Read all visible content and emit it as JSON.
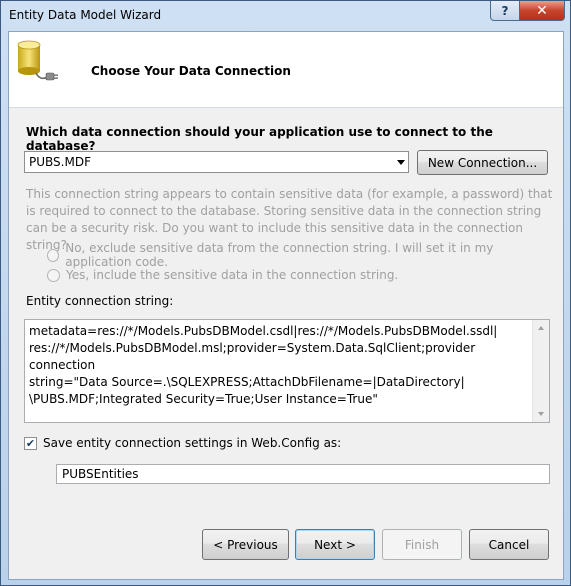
{
  "window": {
    "title": "Entity Data Model Wizard",
    "help_label": "?",
    "close_label": "✕"
  },
  "header": {
    "title": "Choose Your Data Connection",
    "icon": "database-connection-icon"
  },
  "question": "Which data connection should your application use to connect to the database?",
  "connection_select": {
    "selected": "PUBS.MDF"
  },
  "new_connection_label": "New Connection...",
  "sensitive_warning": "This connection string appears to contain sensitive data (for example, a password) that is required to connect to the database. Storing sensitive data in the connection string can be a security risk. Do you want to include this sensitive data in the connection string?",
  "radio_options": {
    "no_label": "No, exclude sensitive data from the connection string. I will set it in my application code.",
    "yes_label": "Yes, include the sensitive data in the connection string."
  },
  "entity_connection": {
    "label": "Entity connection string:",
    "value": "metadata=res://*/Models.PubsDBModel.csdl|res://*/Models.PubsDBModel.ssdl|\nres://*/Models.PubsDBModel.msl;provider=System.Data.SqlClient;provider connection\nstring=\"Data Source=.\\SQLEXPRESS;AttachDbFilename=|DataDirectory|\n\\PUBS.MDF;Integrated Security=True;User Instance=True\""
  },
  "save_settings": {
    "label": "Save entity connection settings in Web.Config as:",
    "checked": true,
    "check_mark": "✔",
    "value": "PUBSEntities"
  },
  "buttons": {
    "previous": "< Previous",
    "next": "Next >",
    "finish": "Finish",
    "cancel": "Cancel"
  },
  "colors": {
    "title_bar": "#b9d1ea",
    "client_bg": "#f0f0f0",
    "disabled_text": "#a0a0a0",
    "close_button": "#c7452c"
  }
}
